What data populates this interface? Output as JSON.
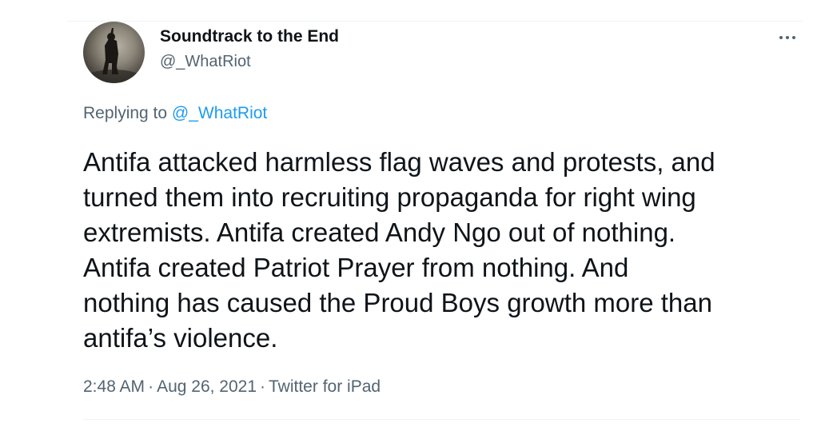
{
  "tweet": {
    "author": {
      "display_name": "Soundtrack to the End",
      "handle": "@_WhatRiot"
    },
    "more_menu_icon": "ellipsis-horizontal-icon",
    "replying_to_label": "Replying to",
    "replying_to_handle": "@_WhatRiot",
    "text_lines": [
      "Antifa attacked harmless flag waves and protests, and",
      "turned them into recruiting propaganda for right wing",
      "extremists. Antifa created Andy Ngo out of nothing.",
      "Antifa created Patriot Prayer from nothing. And",
      "nothing has caused the Proud Boys growth more than",
      "antifa’s violence."
    ],
    "time": "2:48 AM",
    "date": "Aug 26, 2021",
    "source": "Twitter for iPad",
    "separator": "·"
  },
  "colors": {
    "text_primary": "#0f1419",
    "text_secondary": "#536471",
    "accent_blue": "#1d9bf0",
    "divider": "#eff3f4"
  }
}
